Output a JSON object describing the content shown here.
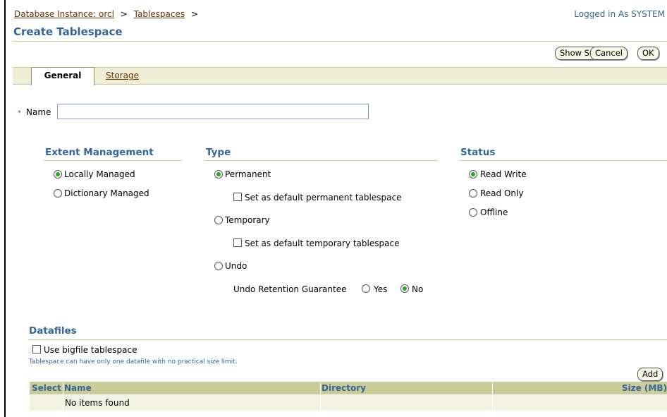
{
  "header": {
    "breadcrumb": [
      "Database Instance: orcl",
      "Tablespaces"
    ],
    "breadcrumb_sep": ">",
    "logged_in": "Logged in As SYSTEM",
    "title": "Create Tablespace"
  },
  "toolbar": {
    "show_sql": "Show SQL",
    "cancel": "Cancel",
    "ok": "OK"
  },
  "tabs": {
    "general": "General",
    "storage": "Storage"
  },
  "name_field": {
    "required_mark": "*",
    "label": "Name",
    "value": ""
  },
  "extent_management": {
    "heading": "Extent Management",
    "options": [
      {
        "label": "Locally Managed",
        "checked": true
      },
      {
        "label": "Dictionary Managed",
        "checked": false
      }
    ]
  },
  "type": {
    "heading": "Type",
    "permanent": "Permanent",
    "permanent_checked": true,
    "default_permanent": "Set as default permanent tablespace",
    "temporary": "Temporary",
    "default_temporary": "Set as default temporary tablespace",
    "undo": "Undo",
    "undo_retention_label": "Undo Retention Guarantee",
    "yes": "Yes",
    "no": "No",
    "undo_retention_value": "No"
  },
  "status": {
    "heading": "Status",
    "options": [
      {
        "label": "Read Write",
        "checked": true
      },
      {
        "label": "Read Only",
        "checked": false
      },
      {
        "label": "Offline",
        "checked": false
      }
    ]
  },
  "datafiles": {
    "heading": "Datafiles",
    "bigfile_label": "Use bigfile tablespace",
    "bigfile_hint": "Tablespace can have only one datafile with no practical size limit.",
    "add_button": "Add",
    "columns": [
      "Select",
      "Name",
      "Directory",
      "Size (MB)"
    ],
    "empty_text": "No items found"
  },
  "colors": {
    "accent": "#336699",
    "link": "#663300",
    "header_bg": "#cccc99",
    "tab_bg": "#eeeed7"
  }
}
